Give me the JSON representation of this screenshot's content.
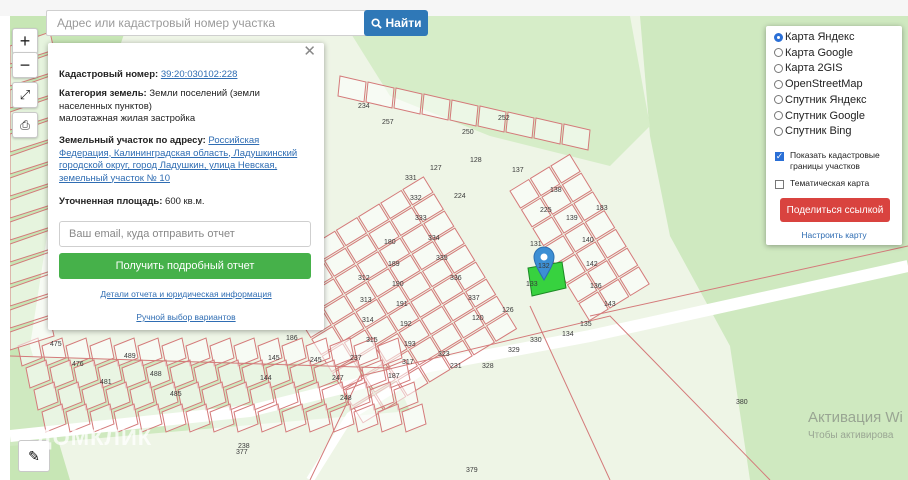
{
  "search": {
    "placeholder": "Адрес или кадастровый номер участка",
    "button_label": "Найти"
  },
  "map_controls": {
    "zoom_in": "+",
    "zoom_out": "−"
  },
  "popup": {
    "cadastral_label": "Кадастровый номер:",
    "cadastral_number": "39:20:030102:228",
    "category_label": "Категория земель:",
    "category_value": "Земли поселений (земли населенных пунктов)",
    "use_value": "малоэтажная жилая застройка",
    "address_label": "Земельный участок по адресу:",
    "address_value": "Российская Федерация, Калининградская область, Ладушкинский городской округ, город Ладушкин, улица Невская, земельный участок № 10",
    "area_label": "Уточненная площадь:",
    "area_value": "600 кв.м.",
    "email_placeholder": "Ваш email, куда отправить отчет",
    "report_button": "Получить подробный отчет",
    "details_link": "Детали отчета и юридическая информация",
    "manual_link": "Ручной выбор вариантов"
  },
  "layers": {
    "options": [
      {
        "label": "Карта Яндекс",
        "selected": true
      },
      {
        "label": "Карта Google",
        "selected": false
      },
      {
        "label": "Карта 2GIS",
        "selected": false
      },
      {
        "label": "OpenStreetMap",
        "selected": false
      },
      {
        "label": "Спутник Яндекс",
        "selected": false
      },
      {
        "label": "Спутник Google",
        "selected": false
      },
      {
        "label": "Спутник Bing",
        "selected": false
      }
    ],
    "show_borders_label": "Показать кадастровые границы участков",
    "show_borders_checked": true,
    "thematic_label": "Тематическая карта",
    "thematic_checked": false,
    "share_button": "Поделиться ссылкой",
    "settings_link": "Настроить карту"
  },
  "watermark": {
    "brand": "ДОМКЛИК",
    "activation_title": "Активация Wi",
    "activation_sub": "Чтобы активирова"
  },
  "parcel_labels": [
    "331",
    "332",
    "333",
    "334",
    "335",
    "336",
    "337",
    "120",
    "126",
    "127",
    "128",
    "137",
    "138",
    "139",
    "140",
    "142",
    "136",
    "143",
    "183",
    "131",
    "132",
    "133",
    "225",
    "224",
    "180",
    "189",
    "190",
    "191",
    "192",
    "193",
    "312",
    "313",
    "314",
    "315",
    "317",
    "323",
    "231",
    "187",
    "328",
    "329",
    "330",
    "134",
    "135",
    "186",
    "245",
    "247",
    "248",
    "237",
    "238",
    "144",
    "145",
    "234",
    "257",
    "250",
    "252",
    "380",
    "379",
    "377",
    "475",
    "476",
    "481",
    "489",
    "488",
    "485"
  ],
  "colors": {
    "parcel_line": "#d47a7a",
    "forest": "#c7e6b5",
    "selected_parcel": "#37d23f",
    "marker": "#3c8fd4"
  }
}
